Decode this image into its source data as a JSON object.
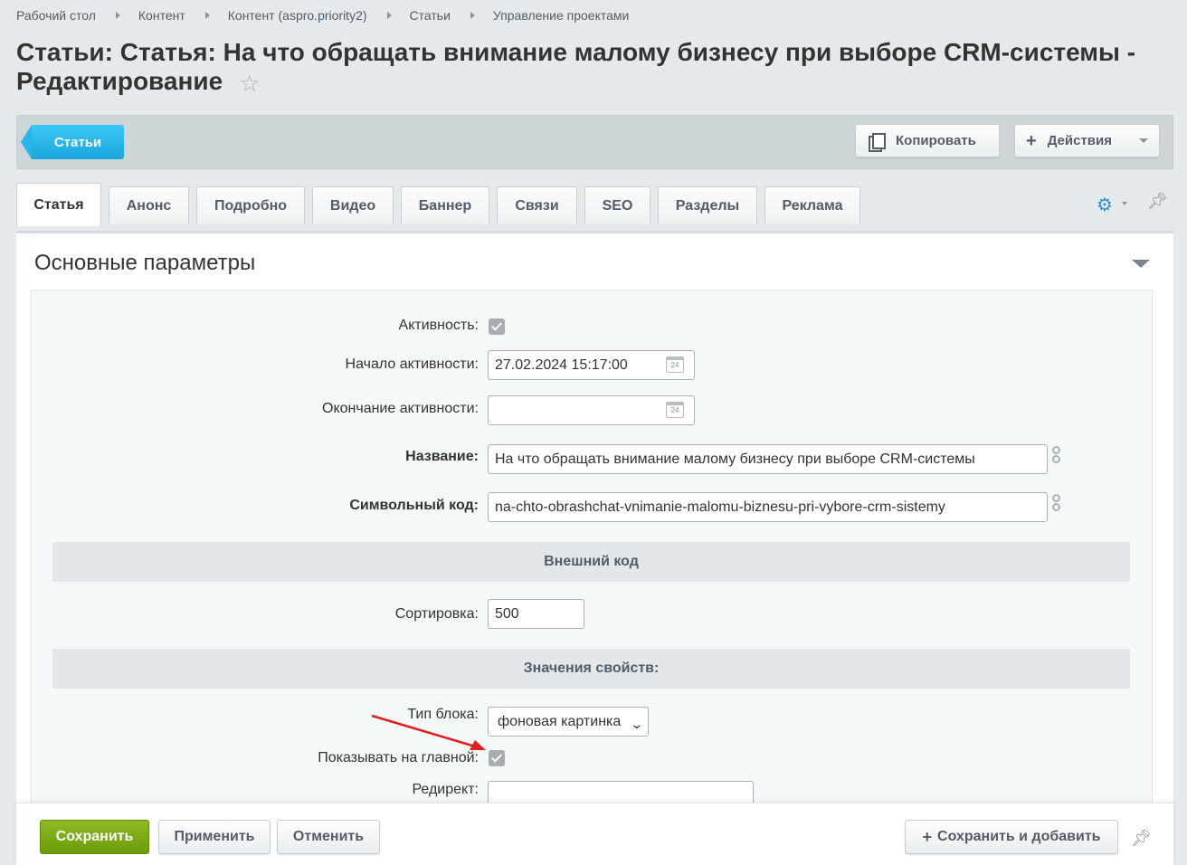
{
  "breadcrumb": [
    "Рабочий стол",
    "Контент",
    "Контент (aspro.priority2)",
    "Статьи",
    "Управление проектами"
  ],
  "page_title": "Статьи: Статья: На что обращать внимание малому бизнесу при выборе CRM-системы - Редактирование",
  "toolbar": {
    "back_label": "Статьи",
    "copy_label": "Копировать",
    "actions_label": "Действия"
  },
  "tabs": [
    "Статья",
    "Анонс",
    "Подробно",
    "Видео",
    "Баннер",
    "Связи",
    "SEO",
    "Разделы",
    "Реклама"
  ],
  "active_tab": "Статья",
  "section_title": "Основные параметры",
  "form": {
    "active_label": "Активность:",
    "active_checked": true,
    "start_label": "Начало активности:",
    "start_value": "27.02.2024 15:17:00",
    "end_label": "Окончание активности:",
    "end_value": "",
    "calendar_day": "24",
    "name_label": "Название:",
    "name_value": "На что обращать внимание малому бизнесу при выборе CRM-системы",
    "code_label": "Символьный код:",
    "code_value": "na-chto-obrashchat-vnimanie-malomu-biznesu-pri-vybore-crm-sistemy",
    "external_code_header": "Внешний код",
    "sort_label": "Сортировка:",
    "sort_value": "500",
    "properties_header": "Значения свойств:",
    "block_type_label": "Тип блока:",
    "block_type_value": "фоновая картинка",
    "show_main_label": "Показывать на главной:",
    "show_main_checked": true,
    "redirect_label": "Редирект:",
    "redirect_value": ""
  },
  "footer": {
    "save_label": "Сохранить",
    "apply_label": "Применить",
    "cancel_label": "Отменить",
    "save_add_label": "Сохранить и добавить"
  },
  "colors": {
    "accent_blue": "#1aa5dc",
    "save_green": "#7aad14",
    "annotation_arrow": "#e02020"
  }
}
